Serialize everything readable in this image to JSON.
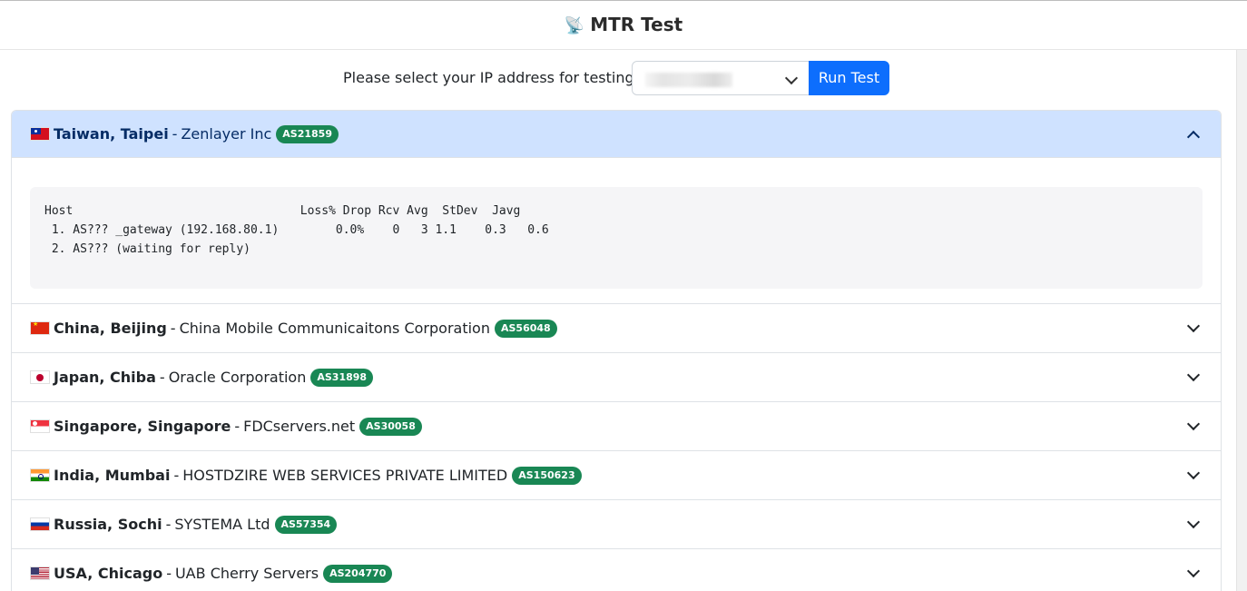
{
  "header": {
    "icon": "satellite-antenna-icon",
    "title": "MTR Test"
  },
  "selector": {
    "label": "Please select your IP address for testing.",
    "selected_value": "",
    "run_button": "Run Test"
  },
  "locations": [
    {
      "flag": "taiwan-flag-icon",
      "location": "Taiwan, Taipei",
      "provider": "Zenlayer Inc",
      "asn": "AS21859",
      "expanded": true,
      "mtr_output": "Host                                Loss% Drop Rcv Avg  StDev  Javg\n 1. AS??? _gateway (192.168.80.1)        0.0%    0   3 1.1    0.3   0.6\n 2. AS??? (waiting for reply)"
    },
    {
      "flag": "china-flag-icon",
      "location": "China, Beijing",
      "provider": "China Mobile Communicaitons Corporation",
      "asn": "AS56048",
      "expanded": false
    },
    {
      "flag": "japan-flag-icon",
      "location": "Japan, Chiba",
      "provider": "Oracle Corporation",
      "asn": "AS31898",
      "expanded": false
    },
    {
      "flag": "singapore-flag-icon",
      "location": "Singapore, Singapore",
      "provider": "FDCservers.net",
      "asn": "AS30058",
      "expanded": false
    },
    {
      "flag": "india-flag-icon",
      "location": "India, Mumbai",
      "provider": "HOSTDZIRE WEB SERVICES PRIVATE LIMITED",
      "asn": "AS150623",
      "expanded": false
    },
    {
      "flag": "russia-flag-icon",
      "location": "Russia, Sochi",
      "provider": "SYSTEMA Ltd",
      "asn": "AS57354",
      "expanded": false
    },
    {
      "flag": "usa-flag-icon",
      "location": "USA, Chicago",
      "provider": "UAB Cherry Servers",
      "asn": "AS204770",
      "expanded": false
    }
  ],
  "separator": "-",
  "colors": {
    "primary": "#0d6efd",
    "badge": "#198754",
    "active_header": "#cfe2ff"
  }
}
